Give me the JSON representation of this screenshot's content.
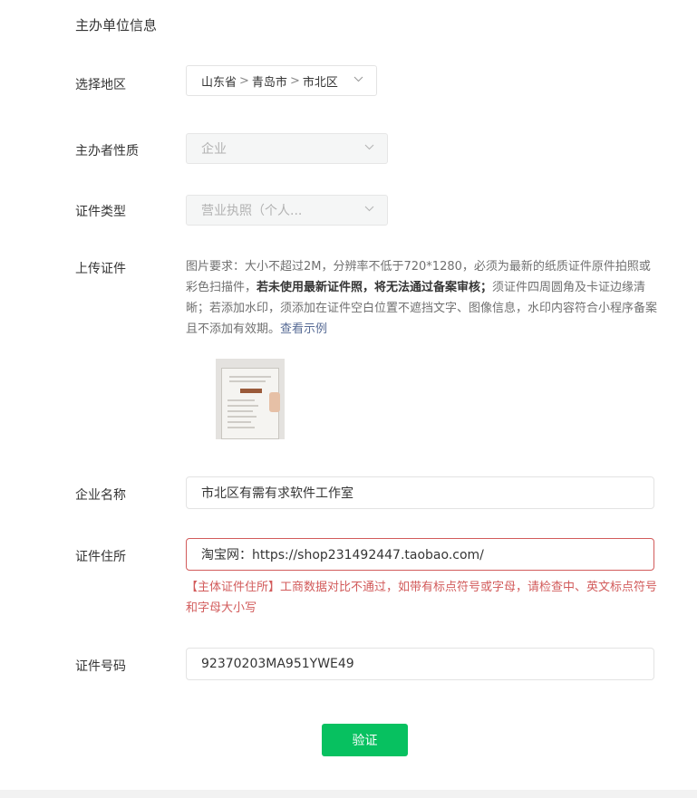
{
  "section_title": "主办单位信息",
  "region": {
    "label": "选择地区",
    "province": "山东省",
    "city": "青岛市",
    "district": "市北区",
    "separator": ">"
  },
  "nature": {
    "label": "主办者性质",
    "value": "企业"
  },
  "cert_type": {
    "label": "证件类型",
    "value": "营业执照（个人..."
  },
  "upload": {
    "label": "上传证件",
    "help_part1": "图片要求：大小不超过2M，分辨率不低于720*1280，必须为最新的纸质证件原件拍照或彩色扫描件，",
    "help_bold": "若未使用最新证件照，将无法通过备案审核；",
    "help_part2": "须证件四周圆角及卡证边缘清晰；若添加水印，须添加在证件空白位置不遮挡文字、图像信息，水印内容符合小程序备案且不添加有效期。",
    "help_link": "查看示例"
  },
  "company_name": {
    "label": "企业名称",
    "value": "市北区有需有求软件工作室"
  },
  "cert_address": {
    "label": "证件住所",
    "value": "淘宝网：https://shop231492447.taobao.com/",
    "error": "【主体证件住所】工商数据对比不通过，如带有标点符号或字母，请检查中、英文标点符号和字母大小写"
  },
  "cert_number": {
    "label": "证件号码",
    "value": "92370203MA951YWE49"
  },
  "verify_button": "验证",
  "colors": {
    "primary": "#07c160",
    "error": "#d25b5b",
    "link": "#576b95"
  }
}
